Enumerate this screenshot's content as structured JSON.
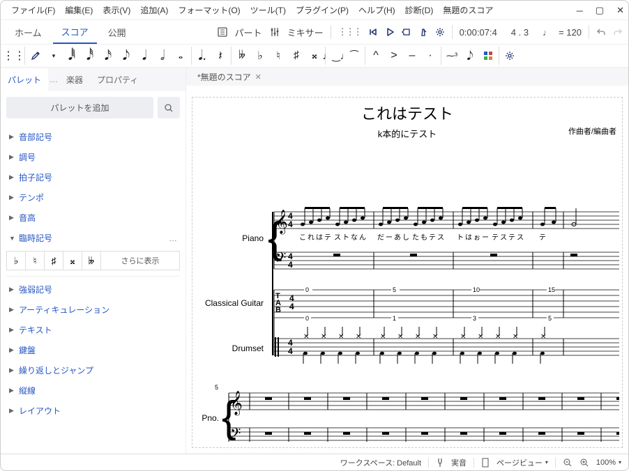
{
  "menubar": {
    "items": [
      "ファイル(F)",
      "編集(E)",
      "表示(V)",
      "追加(A)",
      "フォーマット(O)",
      "ツール(T)",
      "プラグイン(P)",
      "ヘルプ(H)",
      "診断(D)",
      "無題のスコア"
    ]
  },
  "titlebar": {
    "tabs": [
      "ホーム",
      "スコア",
      "公開"
    ],
    "active_tab": 1,
    "parts_label": "パート",
    "mixer_label": "ミキサー",
    "time": "0:00:07:4",
    "beat": "4 . 3",
    "tempo_note": "♩",
    "tempo": "= 120"
  },
  "sidebar": {
    "tabs": [
      "パレット",
      "楽器",
      "プロパティ"
    ],
    "active_tab": 0,
    "add_label": "パレットを追加",
    "items": [
      "音部記号",
      "調号",
      "拍子記号",
      "テンポ",
      "音高",
      "臨時記号",
      "強弱記号",
      "アーティキュレーション",
      "テキスト",
      "鍵盤",
      "繰り返しとジャンプ",
      "縦線",
      "レイアウト"
    ],
    "expanded_index": 5,
    "accidentals": [
      "♭",
      "♮",
      "♯",
      "𝄪",
      "𝄫"
    ],
    "more_label": "さらに表示"
  },
  "doc_tab": {
    "label": "*無題のスコア"
  },
  "score": {
    "title": "これはテスト",
    "subtitle": "k本的にテスト",
    "composer": "作曲者/編曲者",
    "instruments": [
      "Piano",
      "Classical Guitar",
      "Drumset"
    ],
    "short_inst": "Pno.",
    "measure_num": "5",
    "lyrics": [
      "こ",
      "れ",
      "は",
      "テ",
      "ス",
      "ト",
      "な",
      "ん",
      "だ",
      "ー",
      "あ",
      "し",
      "た",
      "も",
      "テ",
      "ス",
      "ト",
      "は",
      "ぉ",
      "ー",
      "テ",
      "ス",
      "テ",
      "ス",
      "テ"
    ],
    "tab_nums_top": [
      "0",
      "5",
      "10",
      "15"
    ],
    "tab_nums_bot": [
      "0",
      "1",
      "3",
      "5"
    ]
  },
  "statusbar": {
    "workspace": "ワークスペース: Default",
    "sound": "実音",
    "view": "ページビュー",
    "zoom": "100%"
  }
}
